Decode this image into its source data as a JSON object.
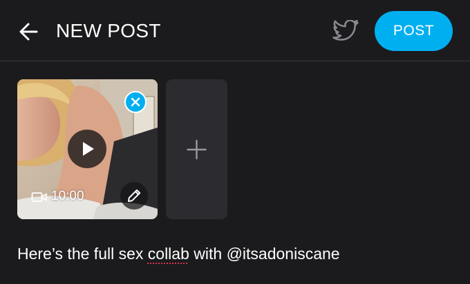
{
  "header": {
    "title": "NEW POST",
    "back_icon": "arrow-left-icon",
    "share_icon": "twitter-bird-icon",
    "post_label": "POST"
  },
  "media": {
    "duration": "10:00",
    "icons": {
      "remove": "close-icon",
      "play": "play-icon",
      "type": "video-camera-icon",
      "edit": "pencil-icon",
      "add": "plus-icon"
    }
  },
  "composer": {
    "text_before": "Here’s the full sex ",
    "misspelled_word": "collab",
    "text_after": " with @itsadoniscane"
  },
  "colors": {
    "background": "#1b1b1d",
    "accent": "#00aff0",
    "tile": "#2b2b30",
    "divider": "#3a3a3e",
    "spellcheck": "#e0334a"
  }
}
